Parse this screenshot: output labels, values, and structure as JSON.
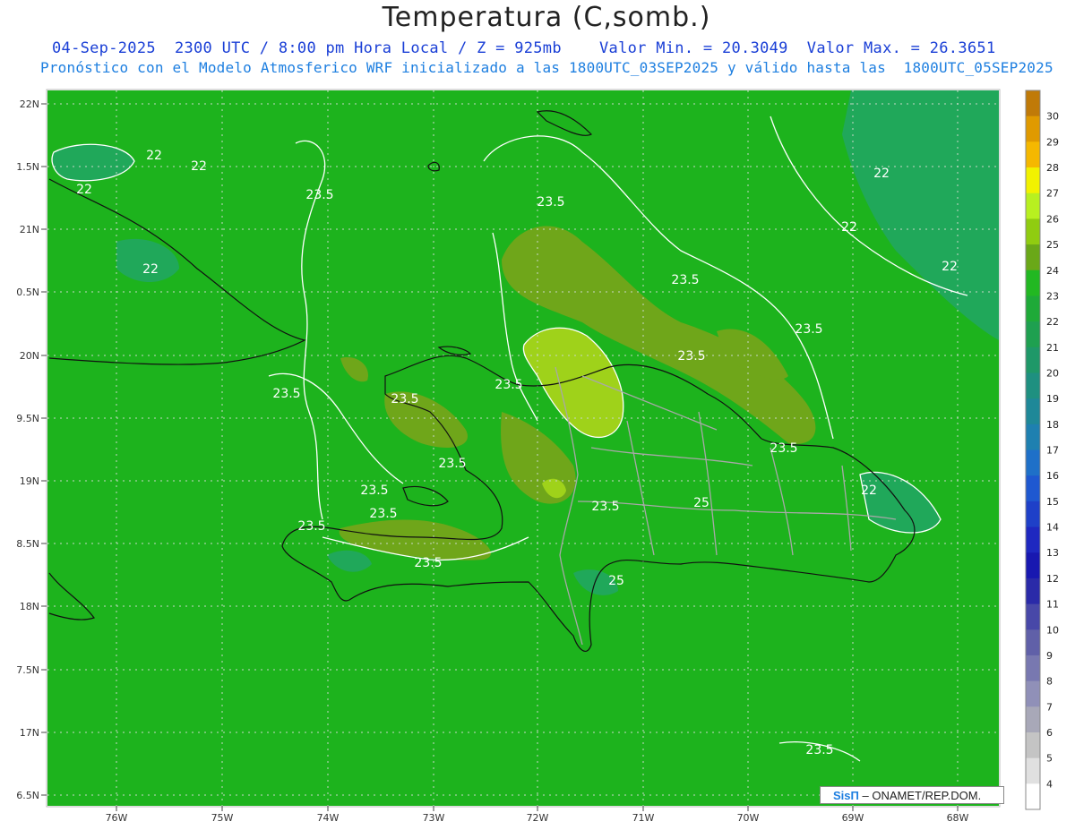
{
  "title": "Temperatura (C,somb.)",
  "subtitle": "04-Sep-2025  2300 UTC / 8:00 pm Hora Local / Z = 925mb    Valor Min. = 20.3049  Valor Max. = 26.3651",
  "subtitle2": "Pronóstico con el Modelo Atmosferico WRF inicializado a las 1800UTC_03SEP2025 y válido hasta las  1800UTC_05SEP2025",
  "credit": {
    "brand": "SisΠ",
    "org": "– ONAMET/REP.DOM."
  },
  "map": {
    "lon_labels": [
      "76W",
      "75W",
      "74W",
      "73W",
      "72W",
      "71W",
      "70W",
      "69W",
      "68W"
    ],
    "lat_labels": [
      "22N",
      "1.5N",
      "21N",
      "0.5N",
      "20N",
      "9.5N",
      "19N",
      "8.5N",
      "18N",
      "7.5N",
      "17N",
      "6.5N"
    ],
    "contour_labels": [
      "22",
      "22",
      "22",
      "22",
      "22",
      "22",
      "22",
      "22",
      "23.5",
      "23.5",
      "23.5",
      "23.5",
      "23.5",
      "23.5",
      "23.5",
      "23.5",
      "23.5",
      "23.5",
      "23.5",
      "23.5",
      "23.5",
      "23.5",
      "23.5",
      "23.5",
      "25",
      "25"
    ],
    "colors": {
      "base": "#1db31d",
      "warm": "#6fa61a",
      "warmer": "#9fd21a",
      "cool": "#20a85a"
    }
  },
  "colorbar": {
    "labels": [
      "30",
      "29",
      "28",
      "27",
      "26",
      "25",
      "24",
      "23",
      "22",
      "21",
      "20",
      "19",
      "18",
      "17",
      "16",
      "15",
      "14",
      "13",
      "12",
      "11",
      "10",
      "9",
      "8",
      "7",
      "6",
      "5",
      "4"
    ],
    "colors": [
      "#c07a08",
      "#e09a00",
      "#f5b800",
      "#f2f200",
      "#b8f020",
      "#90cc10",
      "#6aa818",
      "#22b822",
      "#1eaa38",
      "#1ea050",
      "#1e9868",
      "#1e9080",
      "#1e8898",
      "#1e80b0",
      "#1e70c8",
      "#1e58d0",
      "#1e40c8",
      "#1e28c0",
      "#1818b0",
      "#2a2aa8",
      "#4848a8",
      "#6060a8",
      "#7878b0",
      "#9090b8",
      "#a8a8b8",
      "#c4c4c4",
      "#e0e0e0",
      "#ffffff"
    ]
  }
}
